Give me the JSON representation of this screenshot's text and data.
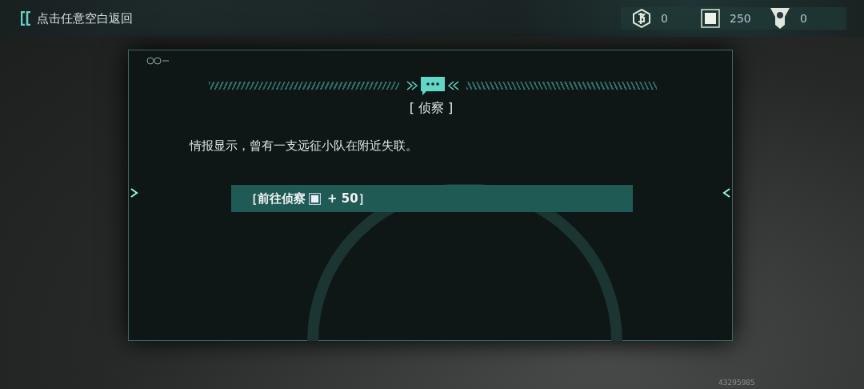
{
  "back_hint": "点击任意空白返回",
  "currencies": [
    {
      "kind": "coin",
      "amount": "0"
    },
    {
      "kind": "chip",
      "amount": "250"
    },
    {
      "kind": "ticket",
      "amount": "0"
    }
  ],
  "dialog": {
    "title": "[ 侦察 ]",
    "message": "情报显示，曾有一支远征小队在附近失联。",
    "options": [
      {
        "label": "［前往侦察",
        "cost": "+ 50］"
      }
    ]
  },
  "uid": "43295985"
}
